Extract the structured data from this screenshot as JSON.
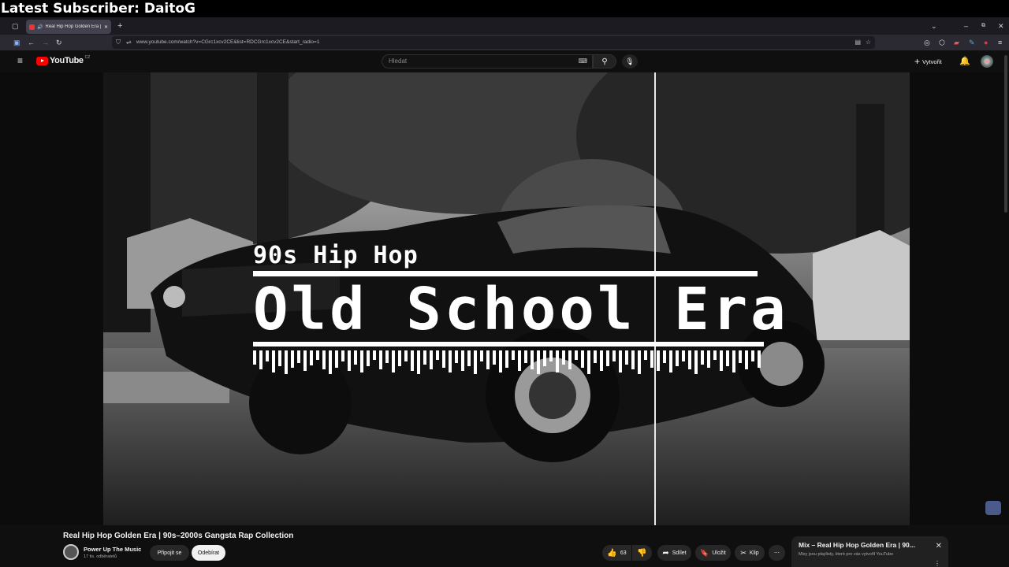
{
  "overlay": {
    "text": "Latest Subscriber: DaitoG"
  },
  "browser": {
    "tab_title": "Real Hip Hop Golden Era |",
    "url": "www.youtube.com/watch?v=CGrc1xcv2CE&list=RDCGrc1xcv2CE&start_radio=1"
  },
  "youtube": {
    "logo_text": "YouTube",
    "country_code": "CZ",
    "search_placeholder": "Hledat",
    "create_label": "Vytvořit"
  },
  "thumbnail": {
    "line1": "90s Hip Hop",
    "line2": "Old School Era"
  },
  "video": {
    "title": "Real Hip Hop Golden Era | 90s–2000s Gangsta Rap Collection",
    "channel": "Power Up The Music",
    "subscribers": "17 tis. odběratelů",
    "join_label": "Připojit se",
    "subscribe_label": "Odebírat",
    "likes": "63",
    "share_label": "Sdílet",
    "save_label": "Uložit",
    "clip_label": "Klip"
  },
  "mix": {
    "title": "Mix – Real Hip Hop Golden Era | 90...",
    "subtitle": "Mixy jsou playlisty, které pro vás vytvořil YouTube"
  }
}
